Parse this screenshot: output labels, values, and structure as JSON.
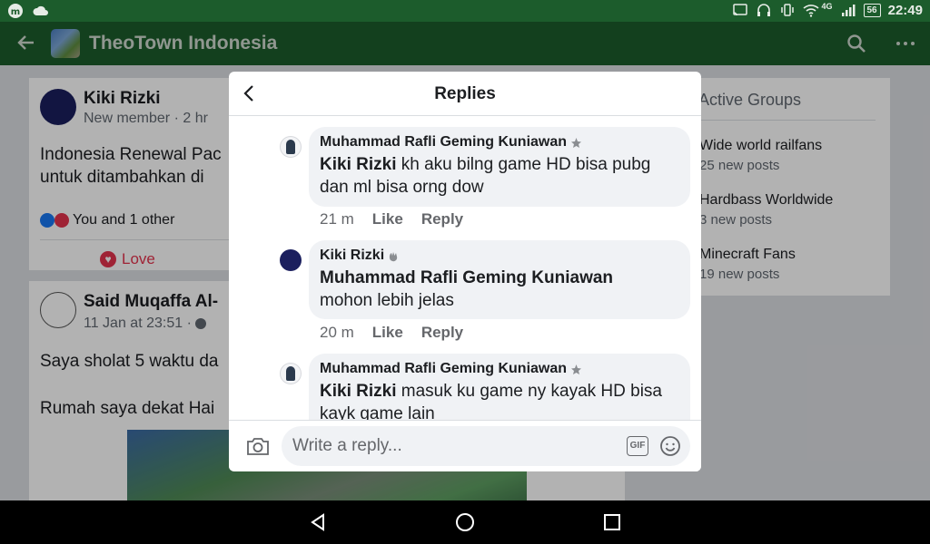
{
  "status_bar": {
    "time": "22:49",
    "battery": "56",
    "network": "4G"
  },
  "app_bar": {
    "title": "TheoTown Indonesia"
  },
  "feed": {
    "post1": {
      "author": "Kiki Rizki",
      "meta": "New member · 2 hr",
      "text_line1": "Indonesia Renewal Pac",
      "text_line2": "untuk ditambahkan di",
      "reactions_text": "You and 1 other",
      "love_label": "Love"
    },
    "post2": {
      "author": "Said Muqaffa Al-",
      "meta": "11 Jan at 23:51 ·",
      "text_line1": "Saya sholat 5 waktu da",
      "text_line2": "Rumah saya dekat Hai"
    }
  },
  "groups": {
    "header": "y Active Groups",
    "items": [
      {
        "name": "Wide world railfans",
        "count": "25 new posts"
      },
      {
        "name": "Hardbass Worldwide",
        "count": "3 new posts"
      },
      {
        "name": "Minecraft Fans",
        "count": "19 new posts"
      }
    ]
  },
  "modal": {
    "title": "Replies",
    "replies": [
      {
        "author": "Muhammad Rafli Geming Kuniawan",
        "mention": "Kiki Rizki",
        "text": " kh aku bilng game HD bisa pubg dan ml bisa orng dow",
        "time": "21 m",
        "like": "Like",
        "reply": "Reply"
      },
      {
        "author": "Kiki Rizki",
        "mention": "Muhammad Rafli Geming Kuniawan",
        "text": "mohon lebih jelas",
        "time": "20 m",
        "like": "Like",
        "reply": "Reply"
      },
      {
        "author": "Muhammad Rafli Geming Kuniawan",
        "mention": "Kiki Rizki",
        "text": " masuk ku game ny kayak HD bisa kayk game lain",
        "time": "",
        "like": "",
        "reply": ""
      }
    ],
    "composer": {
      "placeholder": "Write a reply...",
      "gif_label": "GIF"
    }
  },
  "colors": {
    "app_bar": "#1c5c2c",
    "bubble": "#f0f2f5",
    "love": "#e4334d"
  }
}
